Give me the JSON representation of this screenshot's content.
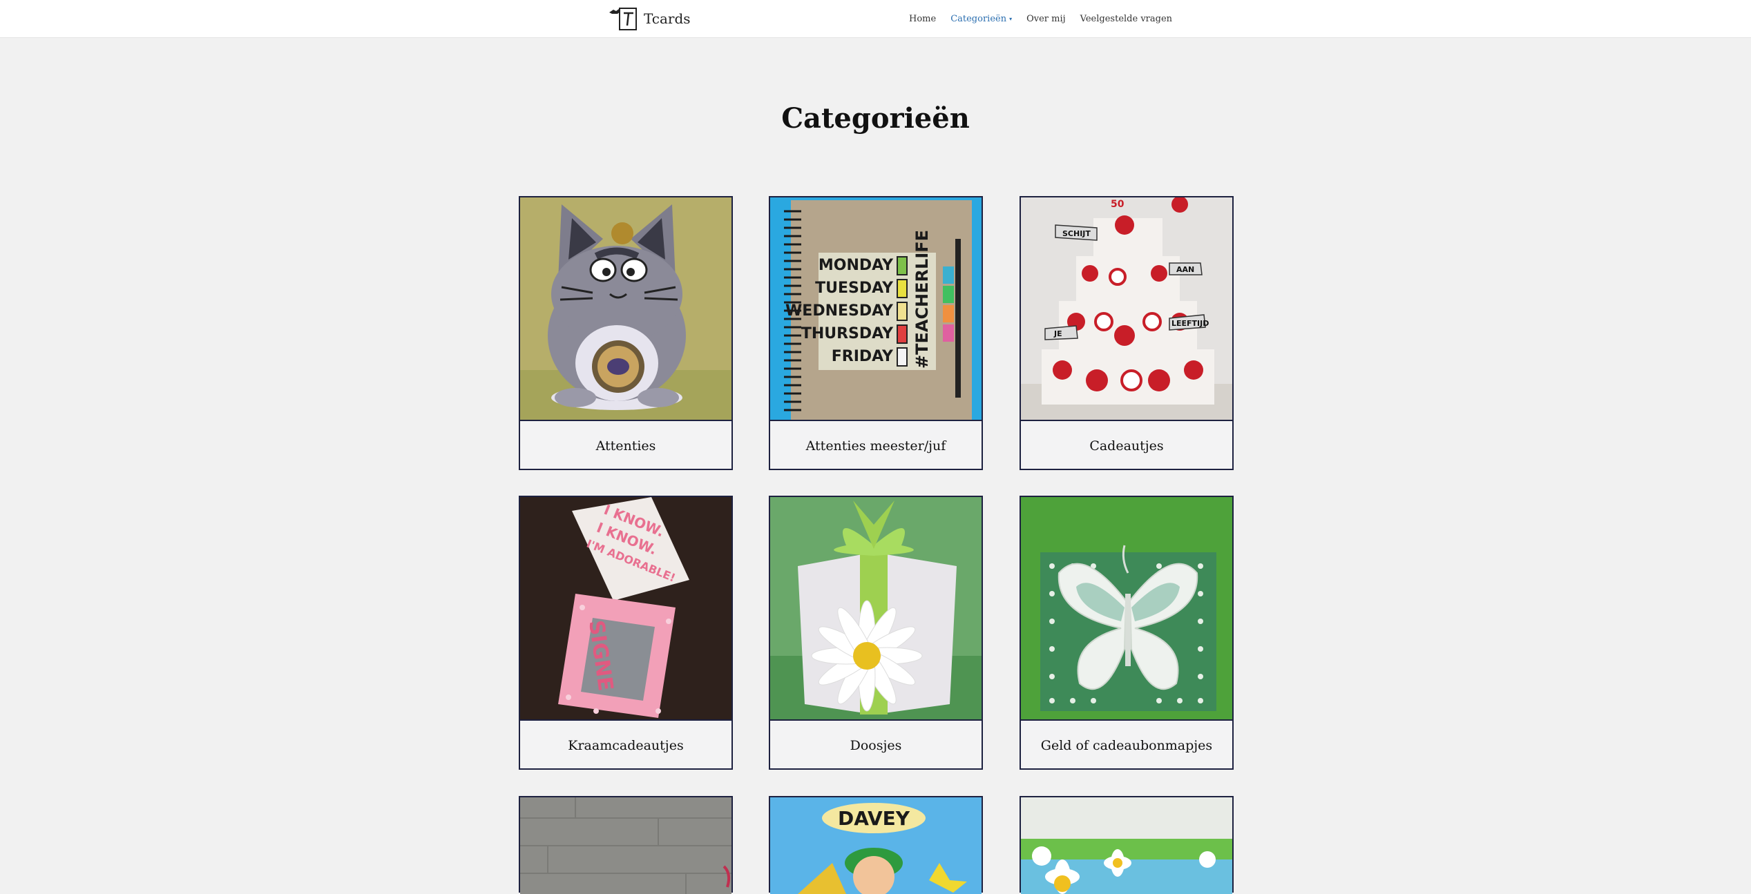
{
  "site": {
    "brand_name": "Tcards"
  },
  "nav": {
    "items": [
      {
        "label": "Home"
      },
      {
        "label": "Categorieën"
      },
      {
        "label": "Over mij"
      },
      {
        "label": "Veelgestelde vragen"
      }
    ]
  },
  "page": {
    "title": "Categorieën"
  },
  "categories": [
    {
      "label": "Attenties"
    },
    {
      "label": "Attenties meester/juf"
    },
    {
      "label": "Cadeautjes"
    },
    {
      "label": "Kraamcadeautjes"
    },
    {
      "label": "Doosjes"
    },
    {
      "label": "Geld of cadeaubonmapjes"
    }
  ],
  "notebook_text": {
    "days": [
      "MONDAY",
      "TUESDAY",
      "WEDNESDAY",
      "THURSDAY",
      "FRIDAY"
    ],
    "hashtag": "#TEACHERLIFE"
  },
  "cake_flags": [
    "SCHIJT",
    "AAN",
    "JE",
    "LEEFTIJD"
  ],
  "cake_number": "50",
  "box_text": [
    "I KNOW.",
    "I KNOW.",
    "I'M ADORABLE!"
  ],
  "box_name": "SIGNE",
  "luigi_text": "DAVEY",
  "colors": {
    "active_nav": "#2c6fb0",
    "card_border": "#1d2140",
    "page_bg": "#f1f1f1"
  }
}
